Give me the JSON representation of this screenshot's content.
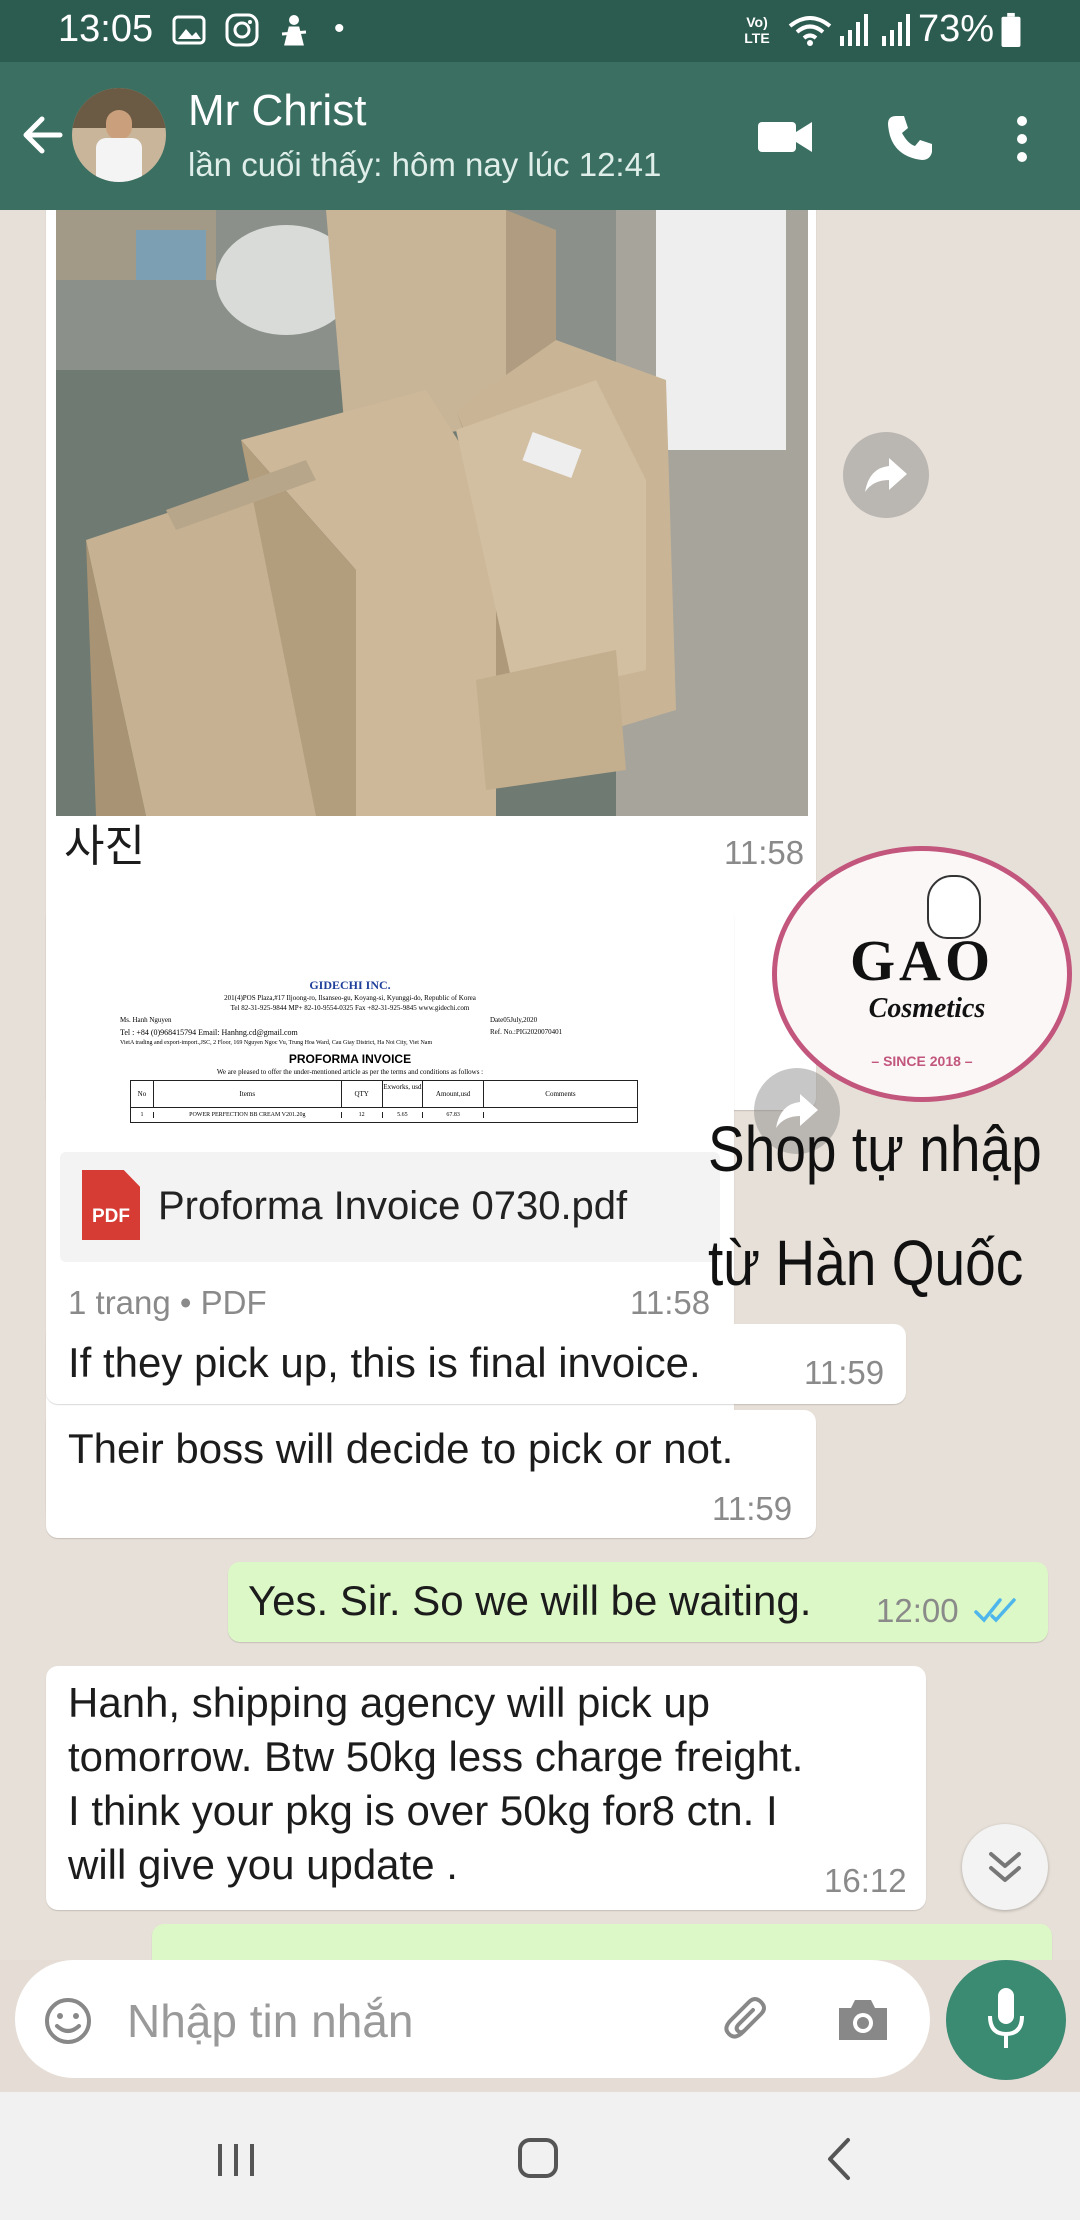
{
  "status_bar": {
    "time": "13:05",
    "network_label": "Vo) LTE",
    "battery": "73%"
  },
  "header": {
    "contact_name": "Mr Christ",
    "last_seen": "lần cuối thấy: hôm nay lúc 12:41"
  },
  "messages": {
    "photo_caption": "사진",
    "photo_time": "11:58",
    "doc": {
      "preview": {
        "company": "GIDECHI INC.",
        "address1": "201(4)POS Plaza,#17 Iljoong-ro, Ilsanseo-gu, Koyang-si, Kyunggi-do, Republic of Korea",
        "address2": "Tel 82-31-925-9844 MP+ 82-10-9554-0325 Fax +82-31-925-9845 www.gidechi.com",
        "to": "Ms. Hanh Nguyen",
        "date": "Date05July,2020",
        "tel": "Tel : +84 (0)968415794   Email: Hanhng.cd@gmail.com",
        "ref": "Ref. No.:PIG2020070401",
        "company2": "VietA trading and export-import.,JSC, 2 Floor, 169 Nguyen Ngoc Vu, Trung Hoa Ward, Cau Giay District, Ha Noi City, Viet Nam",
        "title": "PROFORMA INVOICE",
        "intro": "We are pleased to offer the under-mentioned article as per the terms and conditions as follows :",
        "columns": [
          "No",
          "Items",
          "QTY",
          "Exworks, usd",
          "Amount,usd",
          "Comments"
        ],
        "row": [
          "1",
          "POWER PERFECTION BB CREAM V201.20g",
          "12",
          "5.65",
          "67.83",
          ""
        ]
      },
      "pdf_badge": "PDF",
      "filename": "Proforma Invoice 0730.pdf",
      "meta": "1 trang • PDF",
      "time": "11:58"
    },
    "m1_text": "If they pick up,  this is final invoice.",
    "m1_time": "11:59",
    "m2_text": "Their boss will decide to pick or not.",
    "m2_time": "11:59",
    "m3_text": "Yes. Sir. So we will be waiting.",
    "m3_time": "12:00",
    "m4_lines": [
      "Hanh, shipping agency will pick up",
      "tomorrow. Btw 50kg less  charge freight.",
      "I think your pkg is over 50kg for8 ctn. I",
      "will give you update ."
    ],
    "m4_time": "16:12"
  },
  "watermark": {
    "logo_main": "GAO",
    "logo_sub": "Cosmetics",
    "since": "– SINCE 2018 –",
    "line1": "Shop tự nhập",
    "line2": "từ Hàn Quốc"
  },
  "input": {
    "placeholder": "Nhập tin nhắn"
  },
  "colors": {
    "header": "#3b6f62",
    "status": "#2c5b4f",
    "outgoing": "#dcf8c6",
    "accent": "#3b8a72",
    "read_ticks": "#4fb6ec",
    "pdf_red": "#d63b34"
  }
}
